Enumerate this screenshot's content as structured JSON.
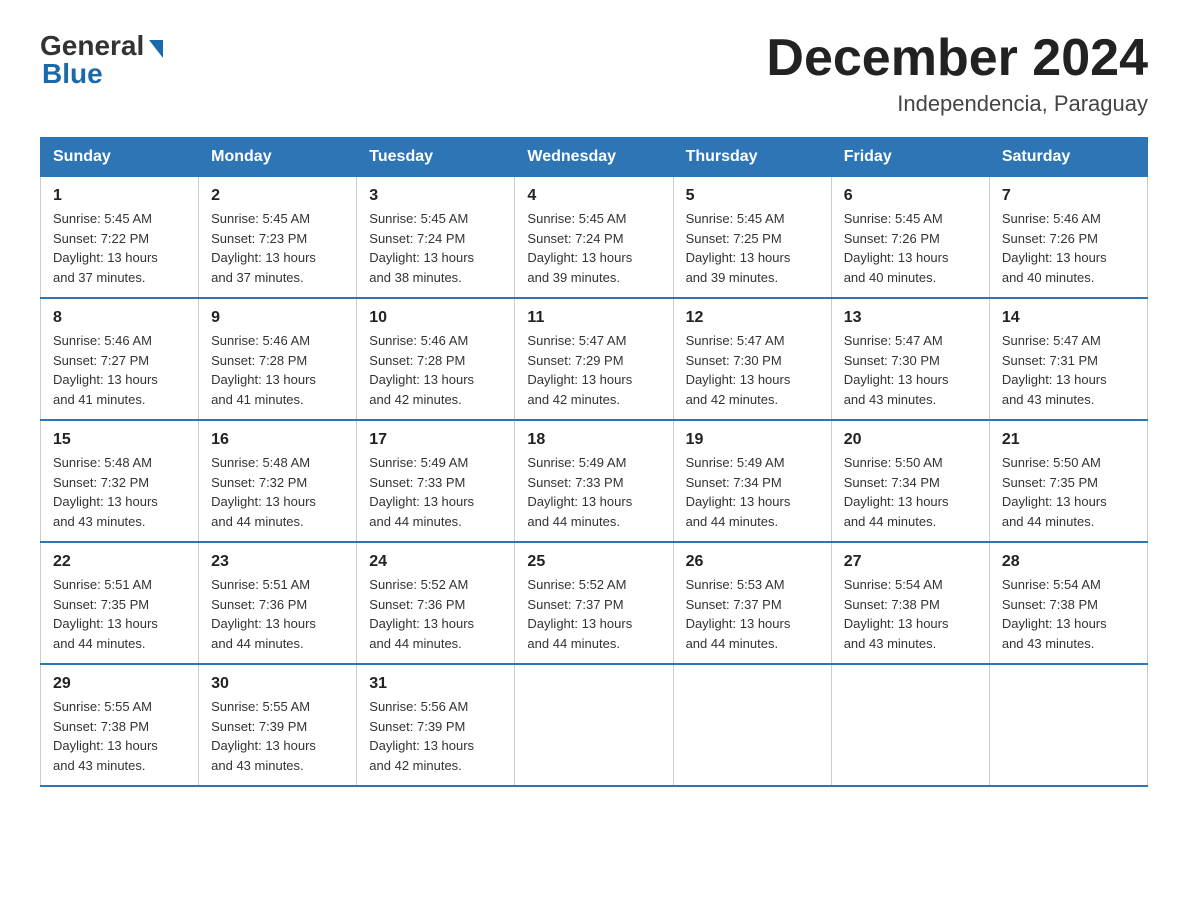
{
  "logo": {
    "general": "General",
    "blue": "Blue"
  },
  "title": "December 2024",
  "subtitle": "Independencia, Paraguay",
  "days_of_week": [
    "Sunday",
    "Monday",
    "Tuesday",
    "Wednesday",
    "Thursday",
    "Friday",
    "Saturday"
  ],
  "weeks": [
    [
      {
        "day": "1",
        "info": "Sunrise: 5:45 AM\nSunset: 7:22 PM\nDaylight: 13 hours\nand 37 minutes."
      },
      {
        "day": "2",
        "info": "Sunrise: 5:45 AM\nSunset: 7:23 PM\nDaylight: 13 hours\nand 37 minutes."
      },
      {
        "day": "3",
        "info": "Sunrise: 5:45 AM\nSunset: 7:24 PM\nDaylight: 13 hours\nand 38 minutes."
      },
      {
        "day": "4",
        "info": "Sunrise: 5:45 AM\nSunset: 7:24 PM\nDaylight: 13 hours\nand 39 minutes."
      },
      {
        "day": "5",
        "info": "Sunrise: 5:45 AM\nSunset: 7:25 PM\nDaylight: 13 hours\nand 39 minutes."
      },
      {
        "day": "6",
        "info": "Sunrise: 5:45 AM\nSunset: 7:26 PM\nDaylight: 13 hours\nand 40 minutes."
      },
      {
        "day": "7",
        "info": "Sunrise: 5:46 AM\nSunset: 7:26 PM\nDaylight: 13 hours\nand 40 minutes."
      }
    ],
    [
      {
        "day": "8",
        "info": "Sunrise: 5:46 AM\nSunset: 7:27 PM\nDaylight: 13 hours\nand 41 minutes."
      },
      {
        "day": "9",
        "info": "Sunrise: 5:46 AM\nSunset: 7:28 PM\nDaylight: 13 hours\nand 41 minutes."
      },
      {
        "day": "10",
        "info": "Sunrise: 5:46 AM\nSunset: 7:28 PM\nDaylight: 13 hours\nand 42 minutes."
      },
      {
        "day": "11",
        "info": "Sunrise: 5:47 AM\nSunset: 7:29 PM\nDaylight: 13 hours\nand 42 minutes."
      },
      {
        "day": "12",
        "info": "Sunrise: 5:47 AM\nSunset: 7:30 PM\nDaylight: 13 hours\nand 42 minutes."
      },
      {
        "day": "13",
        "info": "Sunrise: 5:47 AM\nSunset: 7:30 PM\nDaylight: 13 hours\nand 43 minutes."
      },
      {
        "day": "14",
        "info": "Sunrise: 5:47 AM\nSunset: 7:31 PM\nDaylight: 13 hours\nand 43 minutes."
      }
    ],
    [
      {
        "day": "15",
        "info": "Sunrise: 5:48 AM\nSunset: 7:32 PM\nDaylight: 13 hours\nand 43 minutes."
      },
      {
        "day": "16",
        "info": "Sunrise: 5:48 AM\nSunset: 7:32 PM\nDaylight: 13 hours\nand 44 minutes."
      },
      {
        "day": "17",
        "info": "Sunrise: 5:49 AM\nSunset: 7:33 PM\nDaylight: 13 hours\nand 44 minutes."
      },
      {
        "day": "18",
        "info": "Sunrise: 5:49 AM\nSunset: 7:33 PM\nDaylight: 13 hours\nand 44 minutes."
      },
      {
        "day": "19",
        "info": "Sunrise: 5:49 AM\nSunset: 7:34 PM\nDaylight: 13 hours\nand 44 minutes."
      },
      {
        "day": "20",
        "info": "Sunrise: 5:50 AM\nSunset: 7:34 PM\nDaylight: 13 hours\nand 44 minutes."
      },
      {
        "day": "21",
        "info": "Sunrise: 5:50 AM\nSunset: 7:35 PM\nDaylight: 13 hours\nand 44 minutes."
      }
    ],
    [
      {
        "day": "22",
        "info": "Sunrise: 5:51 AM\nSunset: 7:35 PM\nDaylight: 13 hours\nand 44 minutes."
      },
      {
        "day": "23",
        "info": "Sunrise: 5:51 AM\nSunset: 7:36 PM\nDaylight: 13 hours\nand 44 minutes."
      },
      {
        "day": "24",
        "info": "Sunrise: 5:52 AM\nSunset: 7:36 PM\nDaylight: 13 hours\nand 44 minutes."
      },
      {
        "day": "25",
        "info": "Sunrise: 5:52 AM\nSunset: 7:37 PM\nDaylight: 13 hours\nand 44 minutes."
      },
      {
        "day": "26",
        "info": "Sunrise: 5:53 AM\nSunset: 7:37 PM\nDaylight: 13 hours\nand 44 minutes."
      },
      {
        "day": "27",
        "info": "Sunrise: 5:54 AM\nSunset: 7:38 PM\nDaylight: 13 hours\nand 43 minutes."
      },
      {
        "day": "28",
        "info": "Sunrise: 5:54 AM\nSunset: 7:38 PM\nDaylight: 13 hours\nand 43 minutes."
      }
    ],
    [
      {
        "day": "29",
        "info": "Sunrise: 5:55 AM\nSunset: 7:38 PM\nDaylight: 13 hours\nand 43 minutes."
      },
      {
        "day": "30",
        "info": "Sunrise: 5:55 AM\nSunset: 7:39 PM\nDaylight: 13 hours\nand 43 minutes."
      },
      {
        "day": "31",
        "info": "Sunrise: 5:56 AM\nSunset: 7:39 PM\nDaylight: 13 hours\nand 42 minutes."
      },
      {
        "day": "",
        "info": ""
      },
      {
        "day": "",
        "info": ""
      },
      {
        "day": "",
        "info": ""
      },
      {
        "day": "",
        "info": ""
      }
    ]
  ]
}
